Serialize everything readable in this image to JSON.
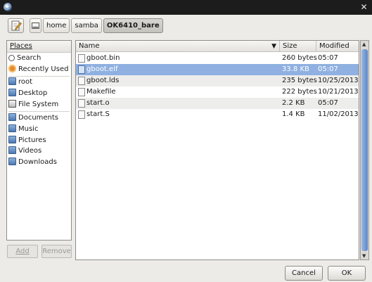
{
  "path_bar": {
    "crumbs": [
      "home",
      "samba",
      "OK6410_bare"
    ]
  },
  "places": {
    "header": "Places",
    "items": [
      {
        "label": "Search",
        "icon": "search-icon"
      },
      {
        "label": "Recently Used",
        "icon": "recent-icon"
      },
      {
        "label": "root",
        "icon": "folder-icon"
      },
      {
        "label": "Desktop",
        "icon": "folder-icon"
      },
      {
        "label": "File System",
        "icon": "drive-icon"
      },
      {
        "label": "Documents",
        "icon": "folder-icon"
      },
      {
        "label": "Music",
        "icon": "folder-icon"
      },
      {
        "label": "Pictures",
        "icon": "folder-icon"
      },
      {
        "label": "Videos",
        "icon": "folder-icon"
      },
      {
        "label": "Downloads",
        "icon": "folder-icon"
      }
    ],
    "add_label": "Add",
    "remove_label": "Remove"
  },
  "files": {
    "columns": {
      "name": "Name",
      "size": "Size",
      "modified": "Modified"
    },
    "rows": [
      {
        "name": "gboot.bin",
        "size": "260 bytes",
        "modified": "05:07"
      },
      {
        "name": "gboot.elf",
        "size": "33.8 KB",
        "modified": "05:07"
      },
      {
        "name": "gboot.lds",
        "size": "235 bytes",
        "modified": "10/25/2013"
      },
      {
        "name": "Makefile",
        "size": "222 bytes",
        "modified": "10/21/2013"
      },
      {
        "name": "start.o",
        "size": "2.2 KB",
        "modified": "05:07"
      },
      {
        "name": "start.S",
        "size": "1.4 KB",
        "modified": "11/02/2013"
      }
    ],
    "selected_index": 1
  },
  "footer": {
    "cancel_label": "Cancel",
    "ok_label": "OK"
  },
  "colors": {
    "selection": "#8fb0e0",
    "titlebar": "#1c1c1c",
    "alt_row": "#ededec"
  }
}
